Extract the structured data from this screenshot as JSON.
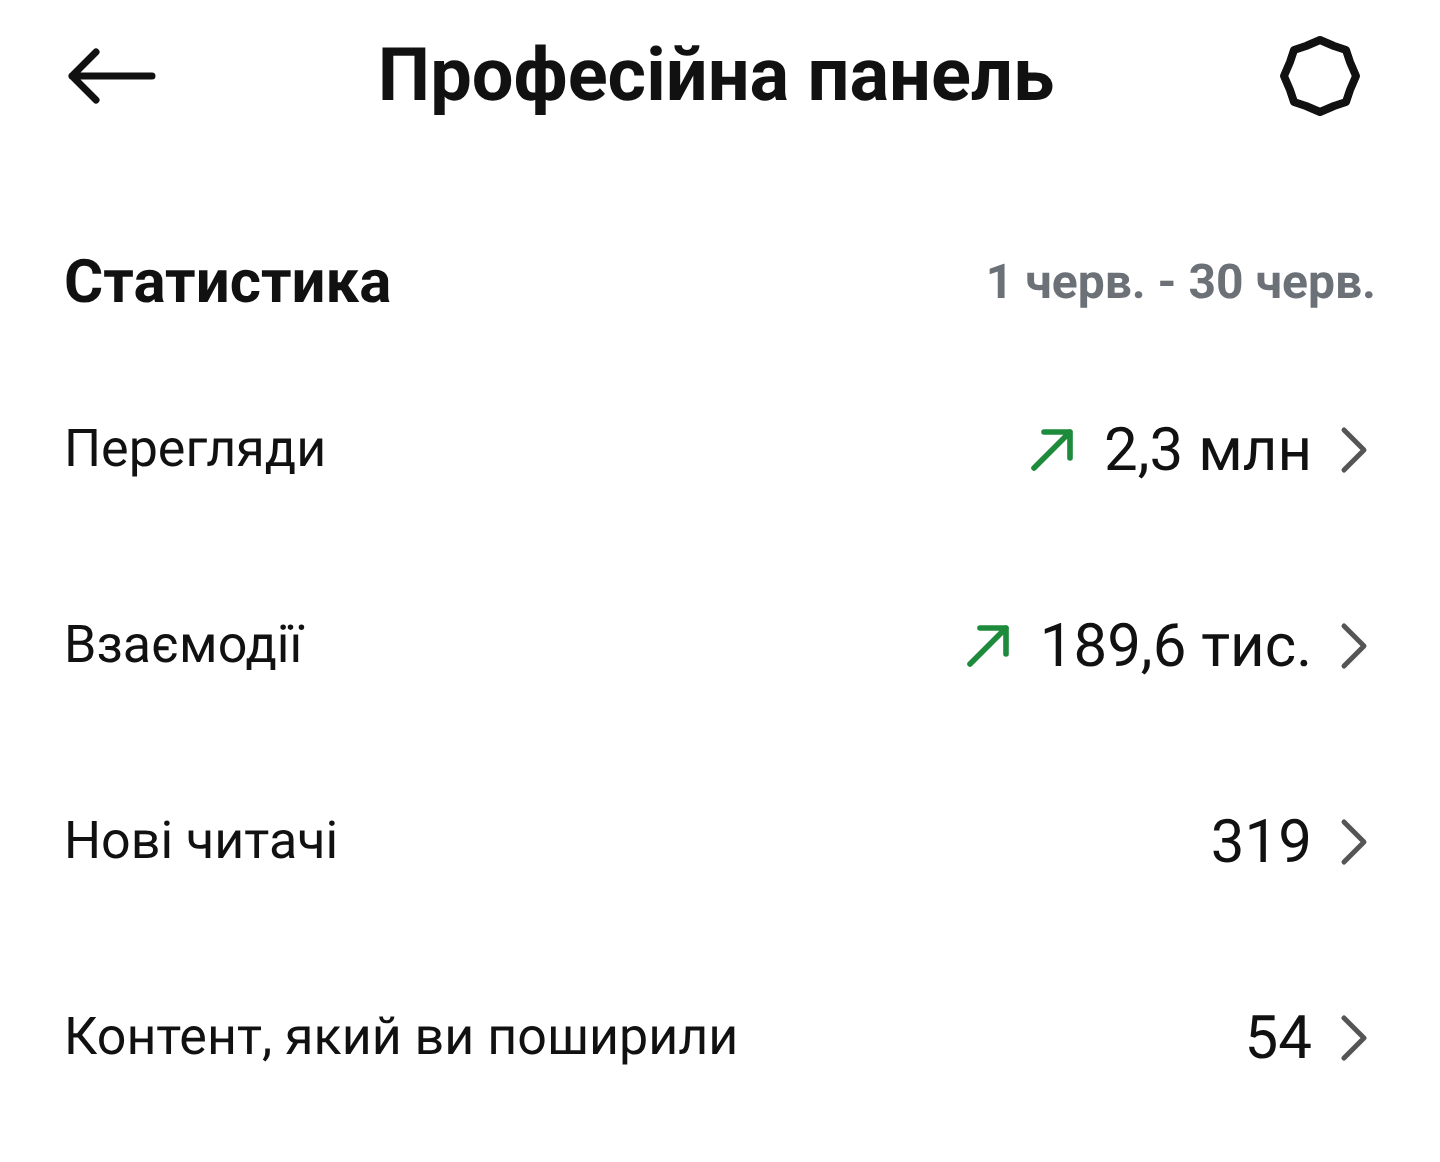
{
  "header": {
    "title": "Професійна панель"
  },
  "stats": {
    "title": "Статистика",
    "date_range": "1 черв. - 30 черв.",
    "rows": [
      {
        "label": "Перегляди",
        "value": "2,3 млн",
        "trend_up": true
      },
      {
        "label": "Взаємодії",
        "value": "189,6 тис.",
        "trend_up": true
      },
      {
        "label": "Нові читачі",
        "value": "319",
        "trend_up": false
      },
      {
        "label": "Контент, який ви поширили",
        "value": "54",
        "trend_up": false
      }
    ]
  }
}
